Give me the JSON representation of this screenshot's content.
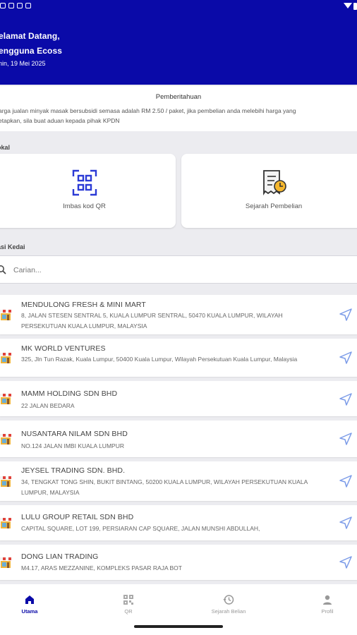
{
  "header": {
    "greeting_line1": "elamat Datang,",
    "greeting_line2": "engguna Ecoss",
    "date": "nin, 19 Mei 2025"
  },
  "notice": {
    "title": "Pemberitahuan",
    "line1": "arga jualan minyak masak bersubsidi semasa adalah RM 2.50 / paket, jika pembelian anda melebihi harga yang",
    "line2": "etapkan, sila buat aduan kepada pihak KPDN"
  },
  "quick_section": {
    "label": "okal",
    "cards": [
      {
        "label": "Imbas kod QR",
        "icon": "qr-scan-icon"
      },
      {
        "label": "Sejarah Pembelian",
        "icon": "purchase-history-icon"
      }
    ]
  },
  "shop_section": {
    "label": "asi Kedai",
    "search_placeholder": "Carian..."
  },
  "shops": [
    {
      "name": "MENDULONG FRESH & MINI MART",
      "address": "8, JALAN STESEN SENTRAL 5, KUALA LUMPUR SENTRAL, 50470 KUALA LUMPUR, WILAYAH PERSEKUTUAN KUALA LUMPUR, MALAYSIA"
    },
    {
      "name": "MK WORLD VENTURES",
      "address": "325, Jln Tun Razak, Kuala Lumpur, 50400 Kuala Lumpur, Wilayah Persekutuan Kuala Lumpur, Malaysia"
    },
    {
      "name": "MAMM HOLDING SDN BHD",
      "address": "22 JALAN BEDARA"
    },
    {
      "name": "NUSANTARA NILAM SDN BHD",
      "address": "NO.124 JALAN IMBI KUALA LUMPUR"
    },
    {
      "name": "JEYSEL TRADING SDN. BHD.",
      "address": "34, TENGKAT TONG SHIN, BUKIT BINTANG, 50200 KUALA LUMPUR, WILAYAH PERSEKUTUAN KUALA LUMPUR, MALAYSIA"
    },
    {
      "name": "LULU GROUP RETAIL SDN BHD",
      "address": "CAPITAL SQUARE, LOT 199, PERSIARAN CAP SQUARE, JALAN MUNSHI ABDULLAH,"
    },
    {
      "name": "DONG LIAN TRADING",
      "address": "M4.17, ARAS MEZZANINE, KOMPLEKS PASAR RAJA BOT"
    }
  ],
  "bottom_nav": [
    {
      "label": "Utama",
      "icon": "home-icon",
      "active": true
    },
    {
      "label": "QR",
      "icon": "qr-icon",
      "active": false
    },
    {
      "label": "Sejarah Belian",
      "icon": "history-icon",
      "active": false
    },
    {
      "label": "Profil",
      "icon": "person-icon",
      "active": false
    }
  ],
  "colors": {
    "primary": "#0a0aa8",
    "background": "#ececf0",
    "nav_arrow": "#7b9be8"
  }
}
